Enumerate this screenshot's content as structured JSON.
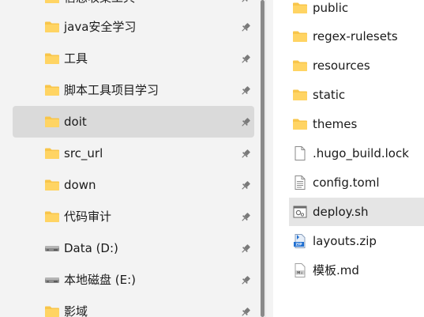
{
  "nav": {
    "items": [
      {
        "label": "信息收集工具",
        "icon": "folder-icon",
        "pinned": true
      },
      {
        "label": "java安全学习",
        "icon": "folder-icon",
        "pinned": true
      },
      {
        "label": "工具",
        "icon": "folder-icon",
        "pinned": true
      },
      {
        "label": "脚本工具项目学习",
        "icon": "folder-icon",
        "pinned": true
      },
      {
        "label": "doit",
        "icon": "folder-icon",
        "pinned": true,
        "selected": true
      },
      {
        "label": "src_url",
        "icon": "folder-icon",
        "pinned": true
      },
      {
        "label": "down",
        "icon": "folder-icon",
        "pinned": true
      },
      {
        "label": "代码审计",
        "icon": "folder-icon",
        "pinned": true
      },
      {
        "label": "Data (D:)",
        "icon": "drive-icon",
        "pinned": true
      },
      {
        "label": "本地磁盘 (E:)",
        "icon": "drive-icon",
        "pinned": true
      },
      {
        "label": "影域",
        "icon": "folder-icon",
        "pinned": true
      }
    ]
  },
  "files": {
    "items": [
      {
        "label": "public",
        "icon": "folder-icon"
      },
      {
        "label": "regex-rulesets",
        "icon": "folder-icon"
      },
      {
        "label": "resources",
        "icon": "folder-icon"
      },
      {
        "label": "static",
        "icon": "folder-icon"
      },
      {
        "label": "themes",
        "icon": "folder-icon"
      },
      {
        "label": ".hugo_build.lock",
        "icon": "blank-file-icon"
      },
      {
        "label": "config.toml",
        "icon": "text-file-icon"
      },
      {
        "label": "deploy.sh",
        "icon": "script-file-icon",
        "selected": true
      },
      {
        "label": "layouts.zip",
        "icon": "zip-file-icon"
      },
      {
        "label": "模板.md",
        "icon": "markdown-file-icon"
      }
    ]
  },
  "colors": {
    "folder": "#f8c54a",
    "nav_selected": "#dadada",
    "file_selected": "#e5e5e5"
  }
}
